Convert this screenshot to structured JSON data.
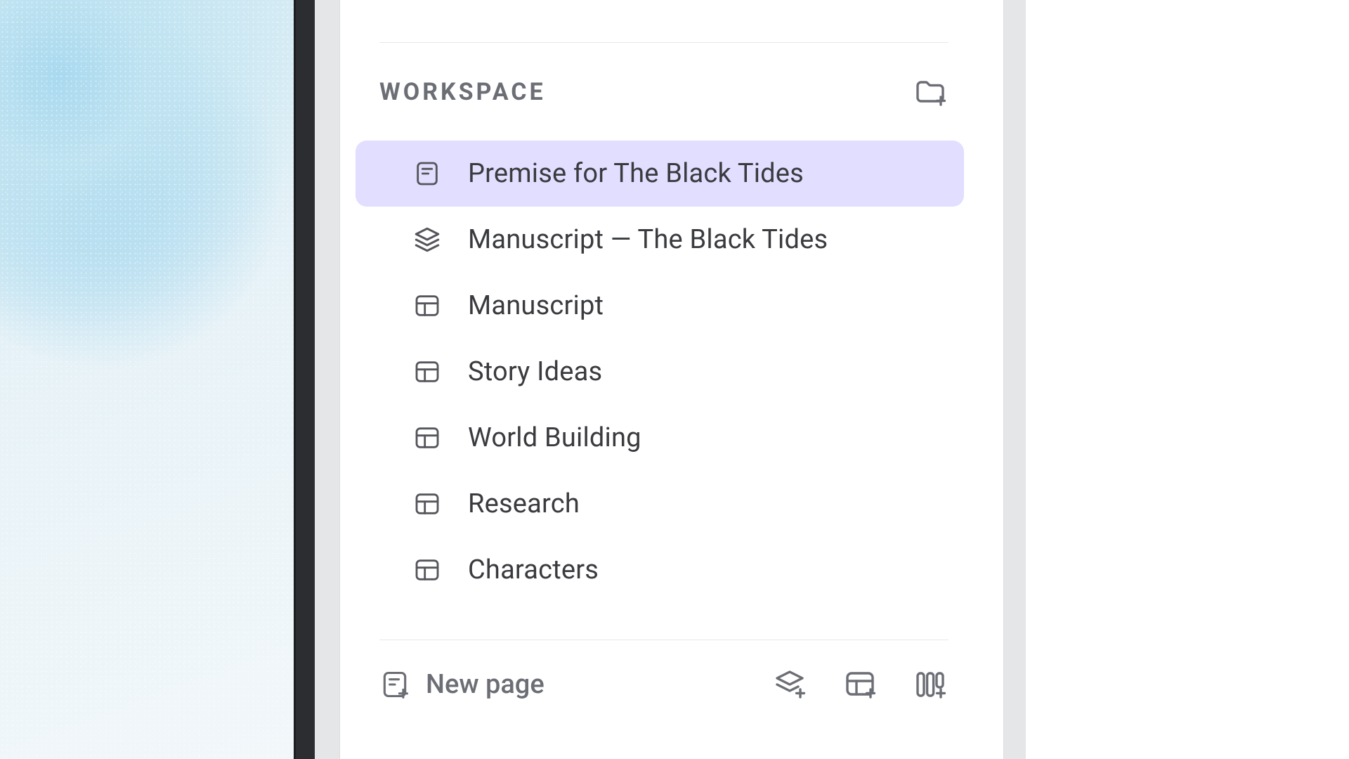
{
  "workspace": {
    "section_label": "WORKSPACE",
    "items": [
      {
        "label": "Premise for The Black Tides",
        "icon": "note",
        "selected": true
      },
      {
        "label": "Manuscript — The Black Tides",
        "icon": "stack",
        "selected": false
      },
      {
        "label": "Manuscript",
        "icon": "table",
        "selected": false
      },
      {
        "label": "Story Ideas",
        "icon": "table",
        "selected": false
      },
      {
        "label": "World Building",
        "icon": "table",
        "selected": false
      },
      {
        "label": "Research",
        "icon": "table",
        "selected": false
      },
      {
        "label": "Characters",
        "icon": "table",
        "selected": false
      }
    ],
    "new_page_label": "New page"
  }
}
